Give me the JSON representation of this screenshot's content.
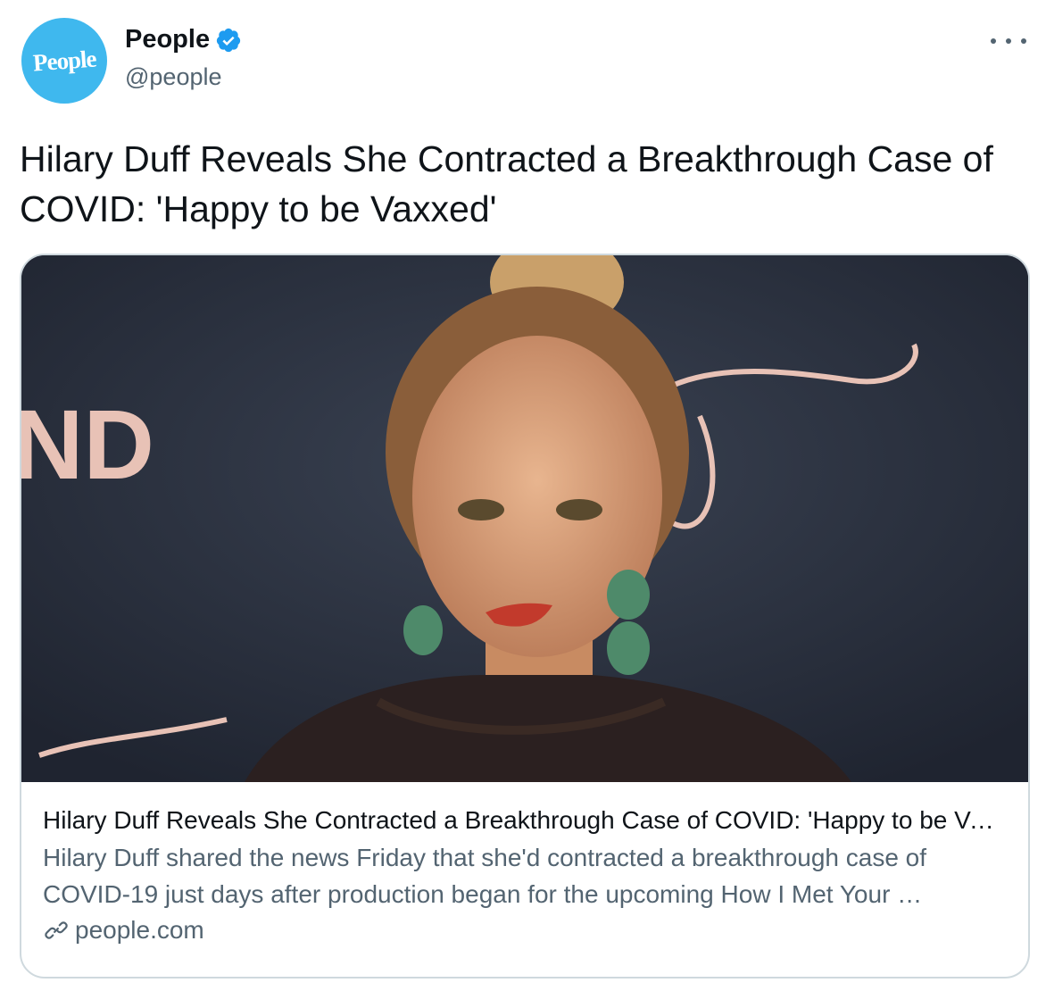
{
  "author": {
    "avatar_text": "People",
    "display_name": "People",
    "handle": "@people",
    "verified_color": "#1d9bf0"
  },
  "tweet": {
    "text": "Hilary Duff Reveals She Contracted a Breakthrough Case of COVID: 'Happy to be Vaxxed'"
  },
  "card": {
    "image_alt": "Hilary Duff smiling on a red carpet",
    "backdrop_text_left": "ND",
    "title": "Hilary Duff Reveals She Contracted a Breakthrough Case of COVID: 'Happy to be Vaxxed'",
    "description_line1": "Hilary Duff shared the news Friday that she'd contracted a breakthrough case of",
    "description_line2": "COVID-19 just days after production began for the upcoming How I Met Your …",
    "domain": "people.com"
  },
  "colors": {
    "avatar_bg": "#3fb8ee",
    "secondary_text": "#536471",
    "border": "#cfd9de"
  },
  "icons": [
    "verified-badge-icon",
    "more-options-icon",
    "link-icon"
  ]
}
